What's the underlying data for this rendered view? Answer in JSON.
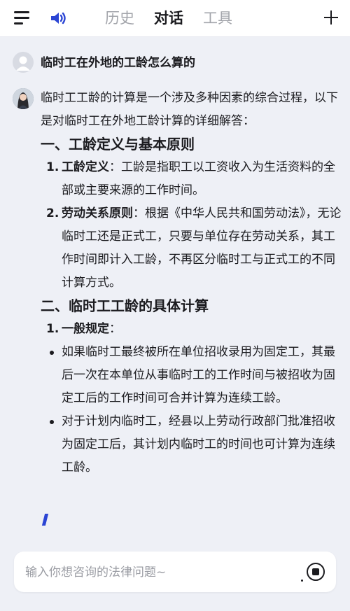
{
  "header": {
    "tabs": [
      {
        "label": "历史",
        "active": false
      },
      {
        "label": "对话",
        "active": true
      },
      {
        "label": "工具",
        "active": false
      }
    ],
    "icons": {
      "menu": "menu-icon",
      "speaker": "speaker-icon",
      "add": "plus-icon"
    },
    "accent_color": "#2b45d4"
  },
  "question": {
    "text": "临时工在外地的工龄怎么算的"
  },
  "answer": {
    "intro": "临时工工龄的计算是一个涉及多种因素的综合过程，以下是对临时工在外地工龄计算的详细解答：",
    "section1": {
      "heading": "一、工龄定义与基本原则",
      "items": [
        {
          "num": "1.",
          "title": "工龄定义",
          "sep": "：",
          "text": "工龄是指职工以工资收入为生活资料的全部或主要来源的工作时间。"
        },
        {
          "num": "2.",
          "title": "劳动关系原则",
          "sep": "：",
          "text": "根据《中华人民共和国劳动法》，无论临时工还是正式工，只要与单位存在劳动关系，其工作时间即计入工龄，不再区分临时工与正式工的不同计算方式。"
        }
      ]
    },
    "section2": {
      "heading": "二、临时工工龄的具体计算",
      "items": [
        {
          "num": "1.",
          "title": "一般规定",
          "sep": "："
        }
      ],
      "bullets": [
        "如果临时工最终被所在单位招收录用为固定工，其最后一次在本单位从事临时工的工作时间与被招收为固定工后的工作时间可合并计算为连续工龄。",
        "对于计划内临时工，经县以上劳动行政部门批准招收为固定工后，其计划内临时工的时间也可计算为连续工龄。"
      ]
    }
  },
  "input": {
    "placeholder": "输入你想咨询的法律问题~",
    "value": ""
  },
  "stop_button": {
    "icon": "stop-circle-icon"
  }
}
